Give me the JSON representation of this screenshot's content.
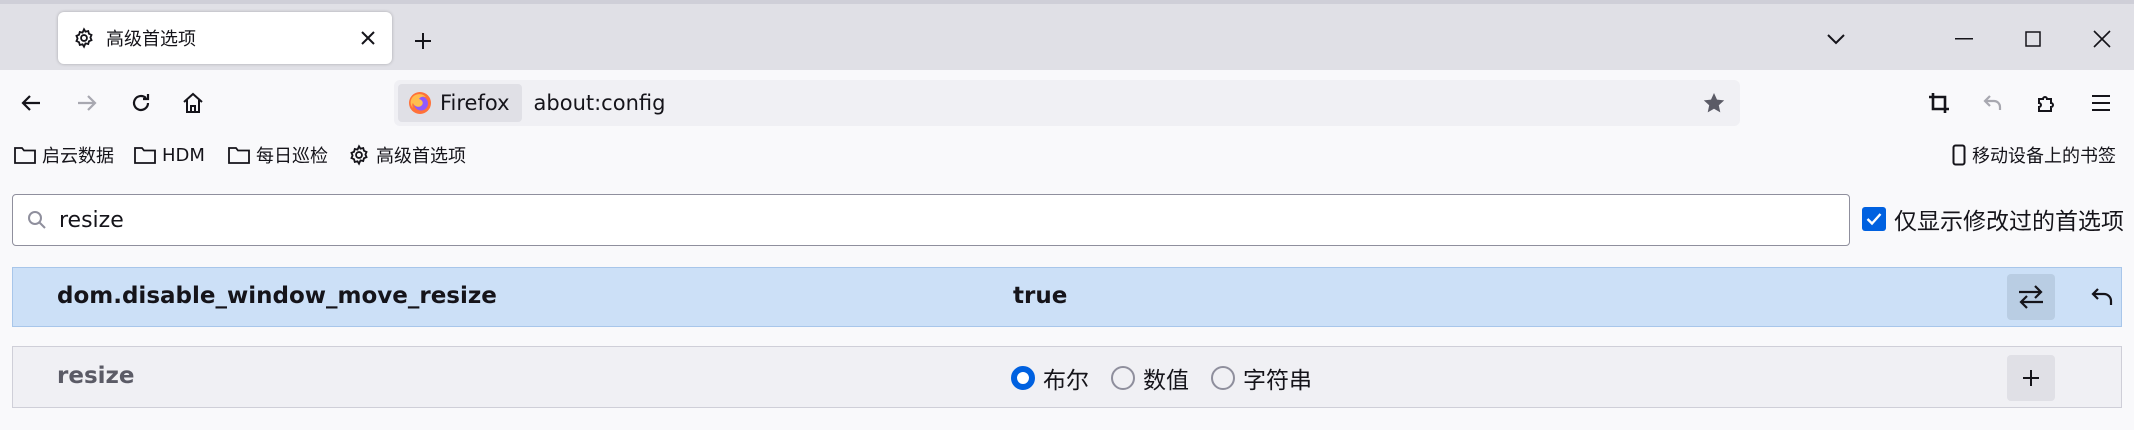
{
  "tab": {
    "title": "高级首选项",
    "icon": "gear-icon"
  },
  "window": {
    "list_tabs_icon": "chevron-down-icon",
    "minimize_icon": "minimize-icon",
    "maximize_icon": "maximize-icon",
    "close_icon": "close-icon"
  },
  "urlbar": {
    "identity_label": "Firefox",
    "url": "about:config"
  },
  "bookmarks": {
    "items": [
      {
        "label": "启云数据",
        "icon": "folder-icon"
      },
      {
        "label": "HDM",
        "icon": "folder-icon"
      },
      {
        "label": "每日巡检",
        "icon": "folder-icon"
      },
      {
        "label": "高级首选项",
        "icon": "gear-icon"
      }
    ],
    "mobile": {
      "label": "移动设备上的书签",
      "icon": "mobile-icon"
    }
  },
  "config": {
    "search_value": "resize",
    "show_modified_label": "仅显示修改过的首选项",
    "show_modified_checked": true,
    "pref": {
      "name": "dom.disable_window_move_resize",
      "value": "true"
    },
    "add": {
      "name": "resize",
      "types": [
        "布尔",
        "数值",
        "字符串"
      ],
      "selected_type": "布尔"
    }
  },
  "colors": {
    "accent": "#0061e0",
    "row_highlight": "#cce0f7"
  }
}
